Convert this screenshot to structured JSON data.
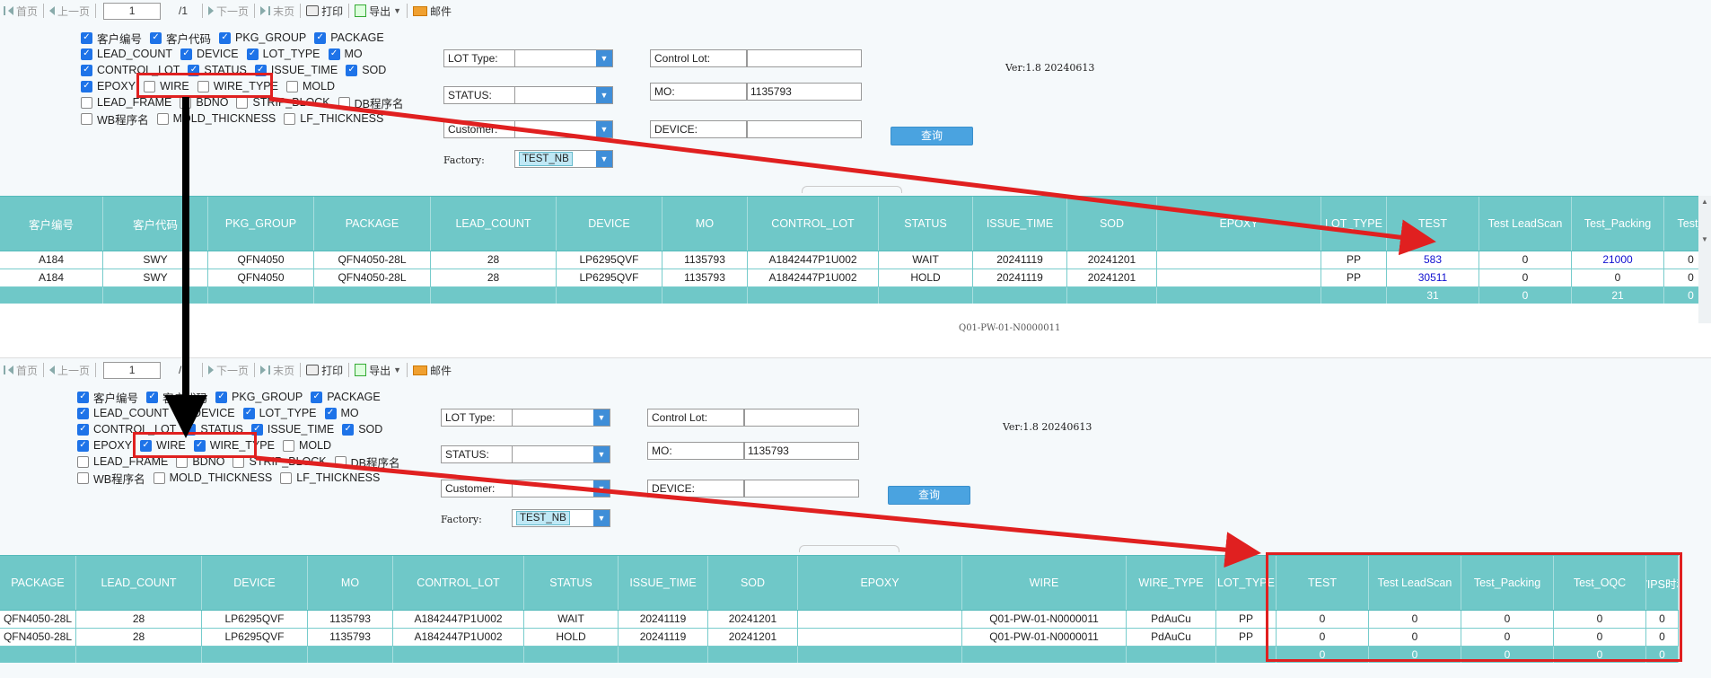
{
  "toolbar": {
    "first": "首页",
    "prev": "上一页",
    "page": "1",
    "total": "/1",
    "next": "下一页",
    "last": "末页",
    "print": "打印",
    "export": "导出",
    "mail": "邮件"
  },
  "filters": {
    "lot_type_label": "LOT Type:",
    "status_label": "STATUS:",
    "customer_label": "Customer:",
    "factory_label": "Factory:",
    "factory_value": "TEST_NB",
    "control_lot_label": "Control Lot:",
    "control_lot_value": "",
    "mo_label": "MO:",
    "mo_value": "1135793",
    "device_label": "DEVICE:",
    "device_value": "",
    "query_button": "查询",
    "version": "Ver:1.8 20240613"
  },
  "panel1": {
    "checkboxes": [
      [
        [
          "客户编号",
          true
        ],
        [
          "客户代码",
          true
        ],
        [
          "PKG_GROUP",
          true
        ],
        [
          "PACKAGE",
          true
        ]
      ],
      [
        [
          "LEAD_COUNT",
          true
        ],
        [
          "DEVICE",
          true
        ],
        [
          "LOT_TYPE",
          true
        ],
        [
          "MO",
          true
        ]
      ],
      [
        [
          "CONTROL_LOT",
          true
        ],
        [
          "STATUS",
          true
        ],
        [
          "ISSUE_TIME",
          true
        ],
        [
          "SOD",
          true
        ]
      ],
      [
        [
          "EPOXY",
          true
        ],
        [
          "WIRE",
          false
        ],
        [
          "WIRE_TYPE",
          false
        ],
        [
          "MOLD",
          false
        ]
      ],
      [
        [
          "LEAD_FRAME",
          false
        ],
        [
          "BDNO",
          false
        ],
        [
          "STRIP_BLOCK",
          false
        ],
        [
          "DB程序名",
          false
        ]
      ],
      [
        [
          "WB程序名",
          false
        ],
        [
          "MOLD_THICKNESS",
          false
        ],
        [
          "LF_THICKNESS",
          false
        ]
      ]
    ],
    "headers": [
      "客户编号",
      "客户代码",
      "PKG_GROUP",
      "PACKAGE",
      "LEAD_COUNT",
      "DEVICE",
      "MO",
      "CONTROL_LOT",
      "STATUS",
      "ISSUE_TIME",
      "SOD",
      "EPOXY",
      "LOT_TYPE",
      "TEST",
      "Test LeadScan",
      "Test_Packing",
      "Test_"
    ],
    "rows": [
      [
        "A184",
        "SWY",
        "QFN4050",
        "QFN4050-28L",
        "28",
        "LP6295QVF",
        "1135793",
        "A1842447P1U002",
        "WAIT",
        "20241119",
        "20241201",
        "",
        "PP",
        "583",
        "0",
        "21000",
        "0"
      ],
      [
        "A184",
        "SWY",
        "QFN4050",
        "QFN4050-28L",
        "28",
        "LP6295QVF",
        "1135793",
        "A1842447P1U002",
        "HOLD",
        "20241119",
        "20241201",
        "",
        "PP",
        "30511",
        "0",
        "0",
        "0"
      ]
    ],
    "totals": [
      "",
      "",
      "",
      "",
      "",
      "",
      "",
      "",
      "",
      "",
      "",
      "",
      "",
      "31",
      "0",
      "21",
      "0"
    ],
    "stray_text": "Q01-PW-01-N0000011"
  },
  "panel2": {
    "checkboxes": [
      [
        [
          "客户编号",
          true
        ],
        [
          "客户代码",
          true
        ],
        [
          "PKG_GROUP",
          true
        ],
        [
          "PACKAGE",
          true
        ]
      ],
      [
        [
          "LEAD_COUNT",
          true
        ],
        [
          "DEVICE",
          true
        ],
        [
          "LOT_TYPE",
          true
        ],
        [
          "MO",
          true
        ]
      ],
      [
        [
          "CONTROL_LOT",
          true
        ],
        [
          "STATUS",
          true
        ],
        [
          "ISSUE_TIME",
          true
        ],
        [
          "SOD",
          true
        ]
      ],
      [
        [
          "EPOXY",
          true
        ],
        [
          "WIRE",
          true
        ],
        [
          "WIRE_TYPE",
          true
        ],
        [
          "MOLD",
          false
        ]
      ],
      [
        [
          "LEAD_FRAME",
          false
        ],
        [
          "BDNO",
          false
        ],
        [
          "STRIP_BLOCK",
          false
        ],
        [
          "DB程序名",
          false
        ]
      ],
      [
        [
          "WB程序名",
          false
        ],
        [
          "MOLD_THICKNESS",
          false
        ],
        [
          "LF_THICKNESS",
          false
        ]
      ]
    ],
    "headers": [
      "PACKAGE",
      "LEAD_COUNT",
      "DEVICE",
      "MO",
      "CONTROL_LOT",
      "STATUS",
      "ISSUE_TIME",
      "SOD",
      "EPOXY",
      "WIRE",
      "WIRE_TYPE",
      "LOT_TYPE",
      "TEST",
      "Test LeadScan",
      "Test_Packing",
      "Test_OQC",
      "WIPS时和"
    ],
    "rows": [
      [
        "QFN4050-28L",
        "28",
        "LP6295QVF",
        "1135793",
        "A1842447P1U002",
        "WAIT",
        "20241119",
        "20241201",
        "",
        "Q01-PW-01-N0000011",
        "PdAuCu",
        "PP",
        "0",
        "0",
        "0",
        "0",
        "0"
      ],
      [
        "QFN4050-28L",
        "28",
        "LP6295QVF",
        "1135793",
        "A1842447P1U002",
        "HOLD",
        "20241119",
        "20241201",
        "",
        "Q01-PW-01-N0000011",
        "PdAuCu",
        "PP",
        "0",
        "0",
        "0",
        "0",
        "0"
      ]
    ],
    "totals": [
      "",
      "",
      "",
      "",
      "",
      "",
      "",
      "",
      "",
      "",
      "",
      "",
      "0",
      "0",
      "0",
      "0",
      "0"
    ]
  },
  "colors": {
    "header_teal": "#6fc8c8",
    "annotation_red": "#e02020",
    "arrow_black": "#000000",
    "link_blue": "#1010d0"
  }
}
